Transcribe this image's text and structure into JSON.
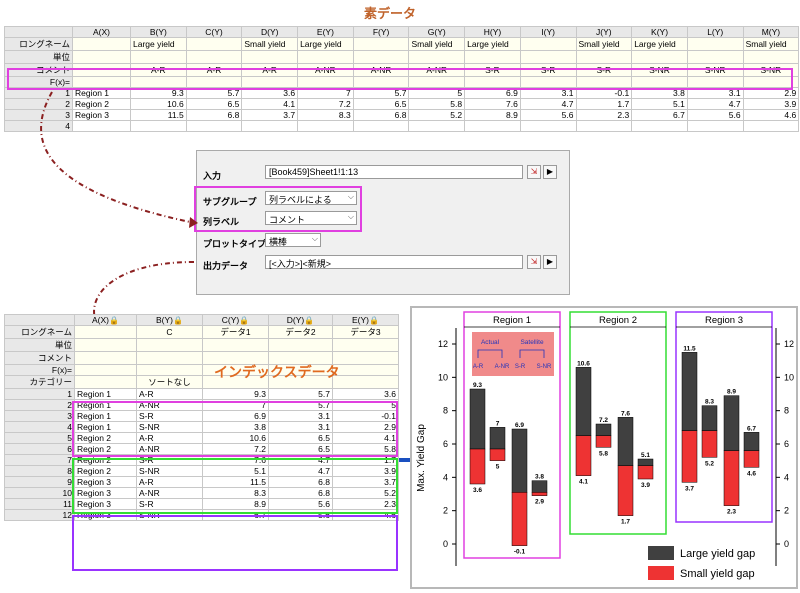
{
  "titles": {
    "raw_data": "素データ",
    "index_data": "インデックスデータ"
  },
  "top_sheet": {
    "row_headers": [
      "ロングネーム",
      "単位",
      "コメント",
      "F(x)="
    ],
    "columns": [
      "A(X)",
      "B(Y)",
      "C(Y)",
      "D(Y)",
      "E(Y)",
      "F(Y)",
      "G(Y)",
      "H(Y)",
      "I(Y)",
      "J(Y)",
      "K(Y)",
      "L(Y)",
      "M(Y)"
    ],
    "longnames": [
      "",
      "Large yield",
      "",
      "Small yield",
      "Large yield",
      "",
      "Small yield",
      "Large yield",
      "",
      "Small yield",
      "Large yield",
      "",
      "Small yield"
    ],
    "comments": [
      "",
      "A-R",
      "A-R",
      "A-R",
      "A-NR",
      "A-NR",
      "A-NR",
      "S-R",
      "S-R",
      "S-R",
      "S-NR",
      "S-NR",
      "S-NR"
    ],
    "rows": [
      {
        "n": "1",
        "cells": [
          "Region 1",
          "9.3",
          "5.7",
          "3.6",
          "7",
          "5.7",
          "5",
          "6.9",
          "3.1",
          "-0.1",
          "3.8",
          "3.1",
          "2.9"
        ]
      },
      {
        "n": "2",
        "cells": [
          "Region 2",
          "10.6",
          "6.5",
          "4.1",
          "7.2",
          "6.5",
          "5.8",
          "7.6",
          "4.7",
          "1.7",
          "5.1",
          "4.7",
          "3.9"
        ]
      },
      {
        "n": "3",
        "cells": [
          "Region 3",
          "11.5",
          "6.8",
          "3.7",
          "8.3",
          "6.8",
          "5.2",
          "8.9",
          "5.6",
          "2.3",
          "6.7",
          "5.6",
          "4.6"
        ]
      },
      {
        "n": "4",
        "cells": [
          "",
          "",
          "",
          "",
          "",
          "",
          "",
          "",
          "",
          "",
          "",
          "",
          ""
        ]
      }
    ]
  },
  "dialog": {
    "input_label": "入力",
    "input_value": "[Book459]Sheet1!1:13",
    "subgroup_label": "サブグループ",
    "subgroup_value": "列ラベルによる",
    "col_label_label": "列ラベル",
    "col_label_value": "コメント",
    "plot_type_label": "プロットタイプ",
    "plot_type_value": "横棒",
    "output_label": "出力データ",
    "output_value": "[<入力>]<新規>"
  },
  "bottom_sheet": {
    "columns": [
      "A(X)",
      "B(Y)",
      "C(Y)",
      "D(Y)",
      "E(Y)"
    ],
    "row_headers": [
      "ロングネーム",
      "単位",
      "コメント",
      "F(x)=",
      "カテゴリー"
    ],
    "longnames": [
      "",
      "C",
      "データ1",
      "データ2",
      "データ3"
    ],
    "category_b": "ソートなし",
    "rows": [
      {
        "n": "1",
        "cells": [
          "Region 1",
          "A-R",
          "9.3",
          "5.7",
          "3.6"
        ]
      },
      {
        "n": "2",
        "cells": [
          "Region 1",
          "A-NR",
          "7",
          "5.7",
          "5"
        ]
      },
      {
        "n": "3",
        "cells": [
          "Region 1",
          "S-R",
          "6.9",
          "3.1",
          "-0.1"
        ]
      },
      {
        "n": "4",
        "cells": [
          "Region 1",
          "S-NR",
          "3.8",
          "3.1",
          "2.9"
        ]
      },
      {
        "n": "5",
        "cells": [
          "Region 2",
          "A-R",
          "10.6",
          "6.5",
          "4.1"
        ]
      },
      {
        "n": "6",
        "cells": [
          "Region 2",
          "A-NR",
          "7.2",
          "6.5",
          "5.8"
        ]
      },
      {
        "n": "7",
        "cells": [
          "Region 2",
          "S-R",
          "7.6",
          "4.7",
          "1.7"
        ]
      },
      {
        "n": "8",
        "cells": [
          "Region 2",
          "S-NR",
          "5.1",
          "4.7",
          "3.9"
        ]
      },
      {
        "n": "9",
        "cells": [
          "Region 3",
          "A-R",
          "11.5",
          "6.8",
          "3.7"
        ]
      },
      {
        "n": "10",
        "cells": [
          "Region 3",
          "A-NR",
          "8.3",
          "6.8",
          "5.2"
        ]
      },
      {
        "n": "11",
        "cells": [
          "Region 3",
          "S-R",
          "8.9",
          "5.6",
          "2.3"
        ]
      },
      {
        "n": "12",
        "cells": [
          "Region 3",
          "S-NR",
          "6.7",
          "5.6",
          "4.6"
        ]
      }
    ]
  },
  "chart_data": {
    "type": "bar",
    "ylabel": "Max. Yield Gap",
    "ylim": [
      -1,
      13
    ],
    "yticks": [
      0,
      2,
      4,
      6,
      8,
      10,
      12
    ],
    "panels": [
      {
        "name": "Region 1",
        "top": [
          9.3,
          7,
          6.9,
          3.8
        ],
        "mid": [
          5.7,
          5.7,
          3.1,
          3.1
        ],
        "bottom": [
          3.6,
          5,
          -0.1,
          2.9
        ]
      },
      {
        "name": "Region 2",
        "top": [
          10.6,
          7.2,
          7.6,
          5.1
        ],
        "mid": [
          6.5,
          6.5,
          4.7,
          4.7
        ],
        "bottom": [
          4.1,
          5.8,
          1.7,
          3.9
        ]
      },
      {
        "name": "Region 3",
        "top": [
          11.5,
          8.3,
          8.9,
          6.7
        ],
        "mid": [
          6.8,
          6.8,
          5.6,
          5.6
        ],
        "bottom": [
          3.7,
          5.2,
          2.3,
          4.6
        ]
      }
    ],
    "inset_labels": {
      "actual": "Actual",
      "satellite": "Satellite",
      "cats": [
        "A-R",
        "A-NR",
        "S-R",
        "S-NR"
      ]
    },
    "legend": [
      "Large yield gap",
      "Small yield gap"
    ],
    "colors": {
      "large": "#404040",
      "small": "#ee3333",
      "panel1": "#e040e0",
      "panel2": "#33dd33",
      "panel3": "#9933ff",
      "inset": "#f08a8a",
      "inset_text": "#2233bb"
    }
  }
}
